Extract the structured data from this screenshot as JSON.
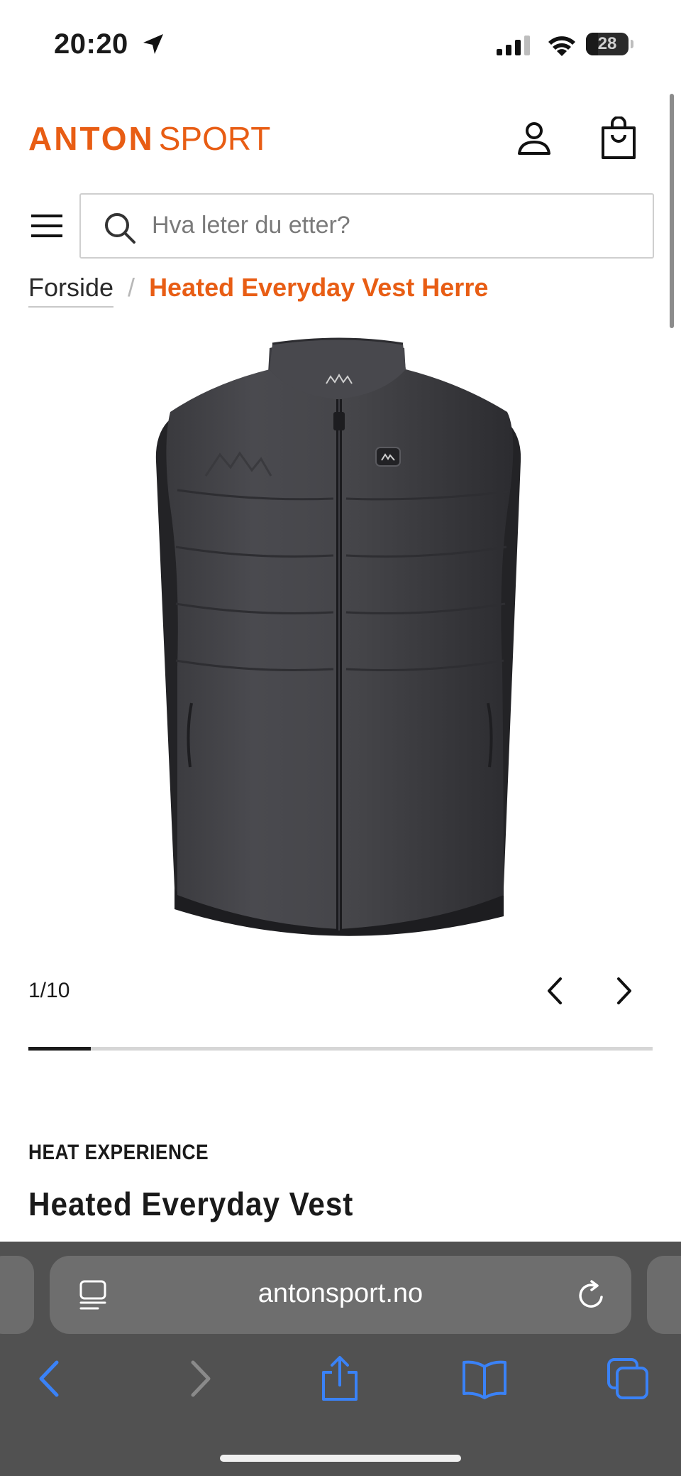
{
  "status_bar": {
    "time": "20:20",
    "battery": "28",
    "battery_level": 0.28
  },
  "header": {
    "logo_part1": "ANTON",
    "logo_part2": "SPORT",
    "brand_color": "#e85d14",
    "account_icon": "user-icon",
    "cart_icon": "shopping-bag-icon",
    "menu_icon": "hamburger-menu-icon"
  },
  "search": {
    "placeholder": "Hva leter du etter?",
    "icon": "search-icon"
  },
  "breadcrumb": {
    "home": "Forside",
    "separator": "/",
    "current": "Heated Everyday Vest Herre"
  },
  "gallery": {
    "counter": "1/10",
    "current_index": 1,
    "total": 10,
    "prev_icon": "chevron-left-icon",
    "next_icon": "chevron-right-icon"
  },
  "product": {
    "brand": "HEAT EXPERIENCE",
    "title": "Heated Everyday Vest"
  },
  "browser": {
    "url": "antonsport.no",
    "toolbar_icons": [
      "back-icon",
      "forward-icon",
      "share-icon",
      "bookmarks-icon",
      "tabs-icon"
    ],
    "accent": "#3a82f7"
  }
}
